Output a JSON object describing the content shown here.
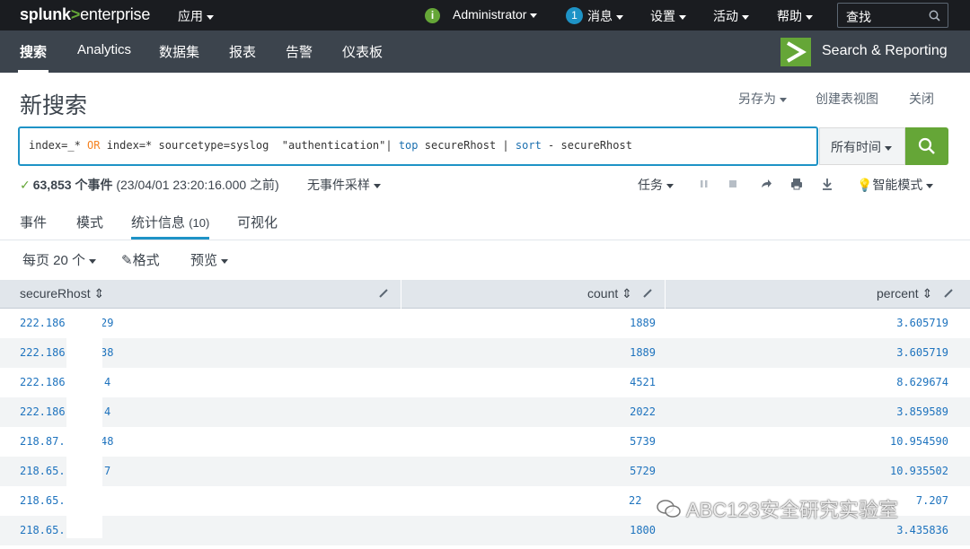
{
  "topbar": {
    "logo_splunk": "splunk",
    "logo_gt": ">",
    "logo_product": "enterprise",
    "apps": "应用",
    "status_icon_text": "i",
    "user": "Administrator",
    "messages_count": "1",
    "messages": "消息",
    "settings": "设置",
    "activity": "活动",
    "help": "帮助",
    "search_placeholder": "查找"
  },
  "appbar": {
    "nav": [
      "搜索",
      "Analytics",
      "数据集",
      "报表",
      "告警",
      "仪表板"
    ],
    "app_name": "Search & Reporting"
  },
  "header": {
    "title": "新搜索",
    "save_as": "另存为",
    "create_table_view": "创建表视图",
    "close": "关闭"
  },
  "search": {
    "q1": "index=_* ",
    "q_or": "OR",
    "q2": " index=* sourcetype=syslog  \"authentication\"| ",
    "q_top": "top",
    "q3": " secureRhost | ",
    "q_sort": "sort",
    "q4": " - secureRhost",
    "time_range": "所有时间",
    "accent_color": "#1e93c6",
    "button_color": "#65a637"
  },
  "status": {
    "count": "63,853 个事件",
    "time": "(23/04/01 23:20:16.000 之前)",
    "sampling": "无事件采样",
    "jobs": "任务",
    "mode": "智能模式"
  },
  "tabs": {
    "events": "事件",
    "patterns": "模式",
    "statistics": "统计信息",
    "statistics_count": "(10)",
    "visualization": "可视化"
  },
  "toolbar": {
    "per_page": "每页 20 个",
    "format": "格式",
    "preview": "预览"
  },
  "table": {
    "columns": [
      "secureRhost",
      "count",
      "percent"
    ],
    "rows": [
      {
        "host": "222.186",
        "host_tail": "29",
        "count": "1889",
        "percent": "3.605719"
      },
      {
        "host": "222.186",
        "host_tail": "38",
        "count": "1889",
        "percent": "3.605719"
      },
      {
        "host": "222.186",
        "host_tail": "4",
        "count": "4521",
        "percent": "8.629674"
      },
      {
        "host": "222.186",
        "host_tail": "4",
        "count": "2022",
        "percent": "3.859589"
      },
      {
        "host": "218.87.1",
        "host_tail": "48",
        "count": "5739",
        "percent": "10.954590"
      },
      {
        "host": "218.65.1",
        "host_tail": "7",
        "count": "5729",
        "percent": "10.935502"
      },
      {
        "host": "218.65.1",
        "host_tail": "",
        "count": "22",
        "percent": "7.207"
      },
      {
        "host": "218.65.1",
        "host_tail": "",
        "count": "1800",
        "percent": "3.435836"
      }
    ]
  },
  "watermark": "ABC123安全研究实验室"
}
